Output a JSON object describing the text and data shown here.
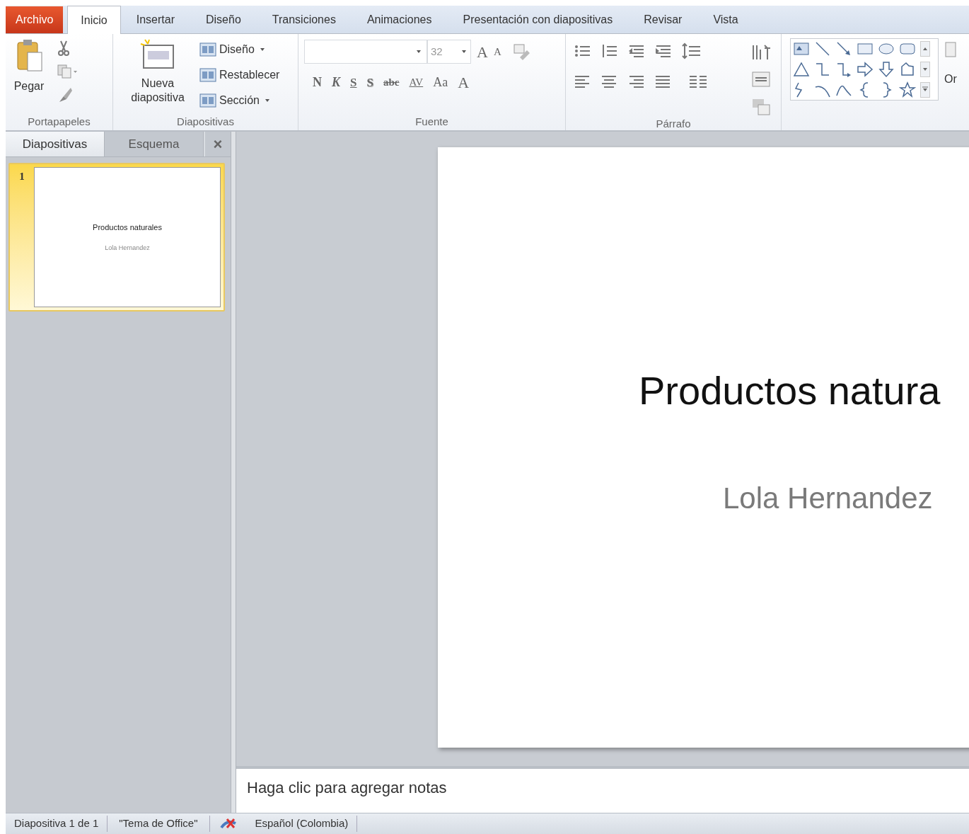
{
  "tabs": [
    {
      "label": "Archivo",
      "kind": "file"
    },
    {
      "label": "Inicio",
      "kind": "tab",
      "selected": true
    },
    {
      "label": "Insertar",
      "kind": "tab",
      "selected": false
    },
    {
      "label": "Diseño",
      "kind": "tab",
      "selected": false
    },
    {
      "label": "Transiciones",
      "kind": "tab",
      "selected": false
    },
    {
      "label": "Animaciones",
      "kind": "tab",
      "selected": false
    },
    {
      "label": "Presentación con diapositivas",
      "kind": "tab",
      "selected": false
    },
    {
      "label": "Revisar",
      "kind": "tab",
      "selected": false
    },
    {
      "label": "Vista",
      "kind": "tab",
      "selected": false
    }
  ],
  "ribbon": {
    "portapapeles": {
      "label": "Portapapeles",
      "paste": "Pegar"
    },
    "diapositivas": {
      "label": "Diapositivas",
      "new_slide": [
        "Nueva",
        "diapositiva"
      ],
      "layout": "Diseño",
      "reset": "Restablecer",
      "section": "Sección"
    },
    "fuente": {
      "label": "Fuente",
      "font_size": "32",
      "grow": "A",
      "shrink": "A",
      "format_buttons": [
        {
          "kind": "bold",
          "label": "N"
        },
        {
          "kind": "italic",
          "label": "K"
        },
        {
          "kind": "underline",
          "label": "S"
        },
        {
          "kind": "shadow",
          "label": "S"
        },
        {
          "kind": "strike",
          "label": "abc"
        },
        {
          "kind": "spacing",
          "label": "AV"
        },
        {
          "kind": "case",
          "label": "Aa"
        },
        {
          "kind": "color",
          "label": "A"
        }
      ]
    },
    "parrafo": {
      "label": "Párrafo"
    },
    "dibujo": {
      "arrange": "Or"
    }
  },
  "side_panel": {
    "tabs": [
      {
        "label": "Diapositivas",
        "selected": true
      },
      {
        "label": "Esquema",
        "selected": false
      }
    ],
    "close": "×",
    "slides": [
      {
        "number": "1",
        "title": "Productos naturales",
        "subtitle": "Lola Hernandez",
        "selected": true
      }
    ]
  },
  "slide": {
    "title": "Productos natura",
    "subtitle": "Lola Hernandez"
  },
  "notes": {
    "placeholder": "Haga clic para agregar notas"
  },
  "status_bar": {
    "slide": "Diapositiva 1 de 1",
    "theme": "\"Tema de Office\"",
    "language": "Español (Colombia)"
  }
}
